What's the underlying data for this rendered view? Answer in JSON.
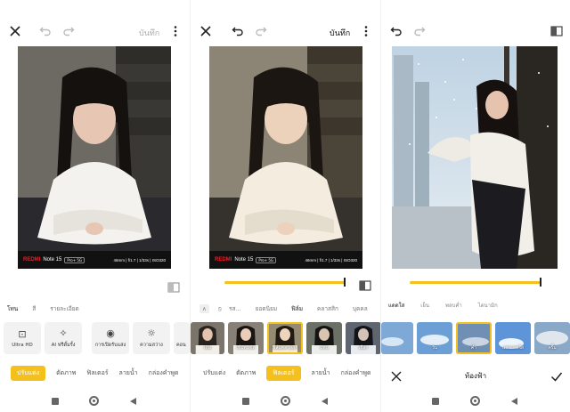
{
  "colors": {
    "accent": "#f4c01e",
    "text": "#222222",
    "muted": "#777777",
    "tile": "#f2f2f2",
    "brand_red": "#e3202a"
  },
  "editor": {
    "save_label": "บันทึก",
    "watermark": {
      "brand": "REDMI",
      "model": "Note 15",
      "tag": "Pro+ 5G",
      "meta": "46mm | f/1.7 | 1/33s | ISO320"
    }
  },
  "panel1": {
    "subtabs": [
      "โทน",
      "สี",
      "รายละเอียด"
    ],
    "tools": [
      {
        "glyph": "⊡",
        "label": "Ultra HD"
      },
      {
        "glyph": "✧",
        "label": "AI ฟรีดั้มรั้ง"
      },
      {
        "glyph": "◉",
        "label": "การเปิดรับแสง"
      },
      {
        "glyph": "☼",
        "label": "ความสว่าง"
      },
      {
        "glyph": "◐",
        "label": "คอน"
      }
    ],
    "bottom_tabs": [
      "ปรับแต่ง",
      "ตัดภาพ",
      "ฟิลเตอร์",
      "ลายน้ำ",
      "กล่องคำพูด"
    ]
  },
  "panel2": {
    "slider_value": 1.0,
    "subtabs": [
      "รส...",
      "ยอดนิยม",
      "ฟิล์ม",
      "คลาสสิก",
      "บุคคล"
    ],
    "thumbs": [
      "เดิม",
      "เพิ่มคมชัด",
      "ฟิล์มคลาสสิก",
      "แทน",
      "เยือก"
    ],
    "bottom_tabs": [
      "ปรับแต่ง",
      "ตัดภาพ",
      "ฟิลเตอร์",
      "ลายน้ำ",
      "กล่องคำพูด"
    ]
  },
  "panel3": {
    "slider_value": 1.0,
    "sky_tabs": [
      "แดดใส",
      "เย็น",
      "พลบค่ำ",
      "ไดนามิก"
    ],
    "sky_thumbs": [
      "",
      "วัน",
      "ค่ำ",
      "แสงแดดใส",
      "ครึ้ม"
    ],
    "title": "ท้องฟ้า"
  }
}
